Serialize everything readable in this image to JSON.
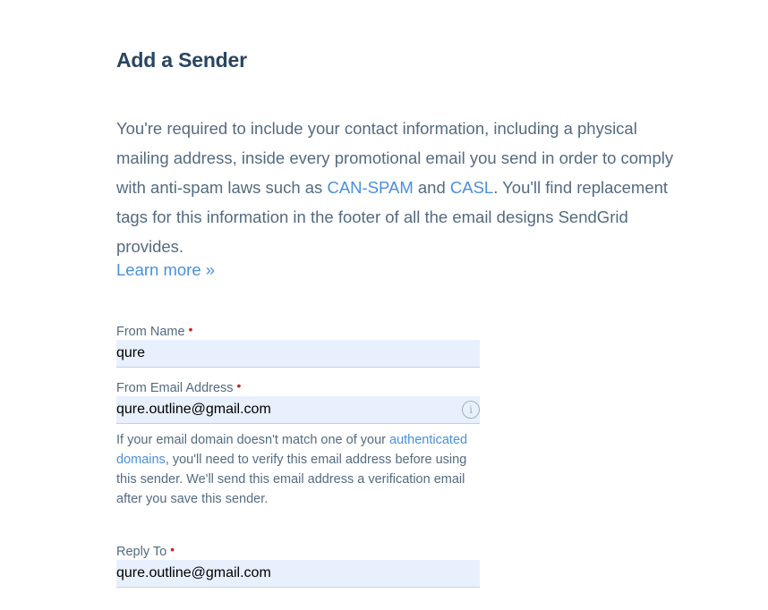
{
  "header": {
    "title": "Add a Sender"
  },
  "intro": {
    "part1": "You're required to include your contact information, including a physical mailing address, inside every promotional email you send in order to comply with anti-spam laws such as ",
    "can_spam": "CAN-SPAM",
    "and": " and ",
    "casl": "CASL",
    "part2": ". You'll find replacement tags for this information in the footer of all the email designs SendGrid provides.",
    "learn_more": "Learn more »"
  },
  "form": {
    "from_name": {
      "label": "From Name",
      "value": "qure"
    },
    "from_email": {
      "label": "From Email Address",
      "value": "qure.outline@gmail.com"
    },
    "help": {
      "part1": "If your email domain doesn't match one of your ",
      "link": "authenticated domains",
      "part2": ", you'll need to verify this email address before using this sender. We'll send this email address a verification email after you save this sender."
    },
    "reply_to": {
      "label": "Reply To",
      "value": "qure.outline@gmail.com"
    },
    "required_mark": "•",
    "info_icon_glyph": "i"
  }
}
